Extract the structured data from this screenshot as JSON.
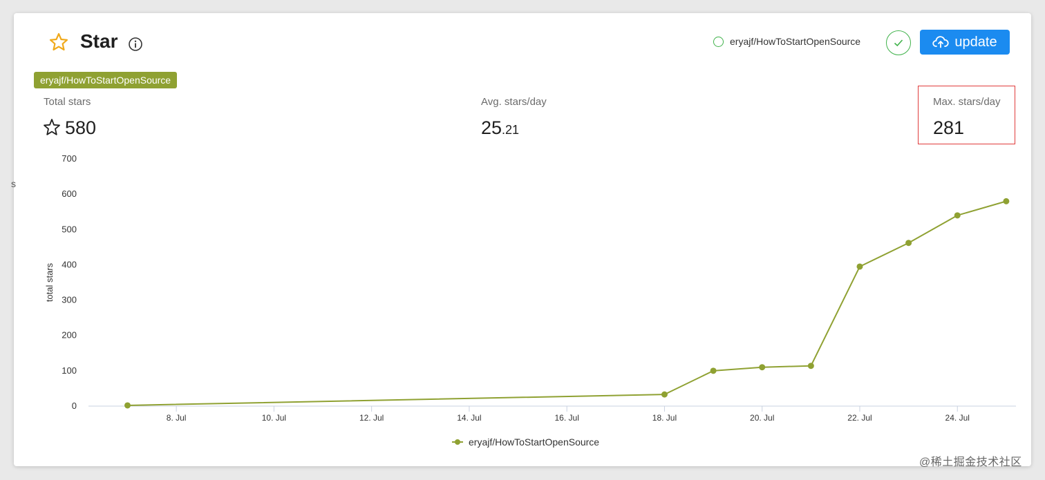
{
  "edge_glyph": "s",
  "header": {
    "title": "Star",
    "repo_option": "eryajf/HowToStartOpenSource",
    "update_label": "update"
  },
  "repo_tag": "eryajf/HowToStartOpenSource",
  "stats": {
    "total": {
      "label": "Total stars",
      "value": "580"
    },
    "avg": {
      "label": "Avg. stars/day",
      "value_int": "25",
      "value_frac": ".21"
    },
    "max": {
      "label": "Max. stars/day",
      "value": "281"
    }
  },
  "colors": {
    "accent": "#1b8bf0",
    "series": "#8fa132",
    "success": "#3fb24a",
    "highlight": "#e03a3a"
  },
  "icons": [
    "star-outline-icon",
    "info-icon",
    "check-icon",
    "cloud-upload-icon"
  ],
  "chart_data": {
    "type": "line",
    "ylabel": "total stars",
    "xlabel": "",
    "ylim": [
      0,
      700
    ],
    "yticks": [
      0,
      100,
      200,
      300,
      400,
      500,
      600,
      700
    ],
    "xticks": [
      "8. Jul",
      "10. Jul",
      "12. Jul",
      "14. Jul",
      "16. Jul",
      "18. Jul",
      "20. Jul",
      "22. Jul",
      "24. Jul"
    ],
    "xtick_days": [
      8,
      10,
      12,
      14,
      16,
      18,
      20,
      22,
      24
    ],
    "xrange_days": [
      6.2,
      25.2
    ],
    "series": [
      {
        "name": "eryajf/HowToStartOpenSource",
        "color": "#8fa132",
        "x": [
          7,
          18,
          19,
          20,
          21,
          22,
          23,
          24,
          25
        ],
        "y": [
          2,
          33,
          100,
          110,
          114,
          395,
          462,
          540,
          580
        ]
      }
    ],
    "legend": "bottom-center"
  },
  "watermark": "@稀土掘金技术社区"
}
